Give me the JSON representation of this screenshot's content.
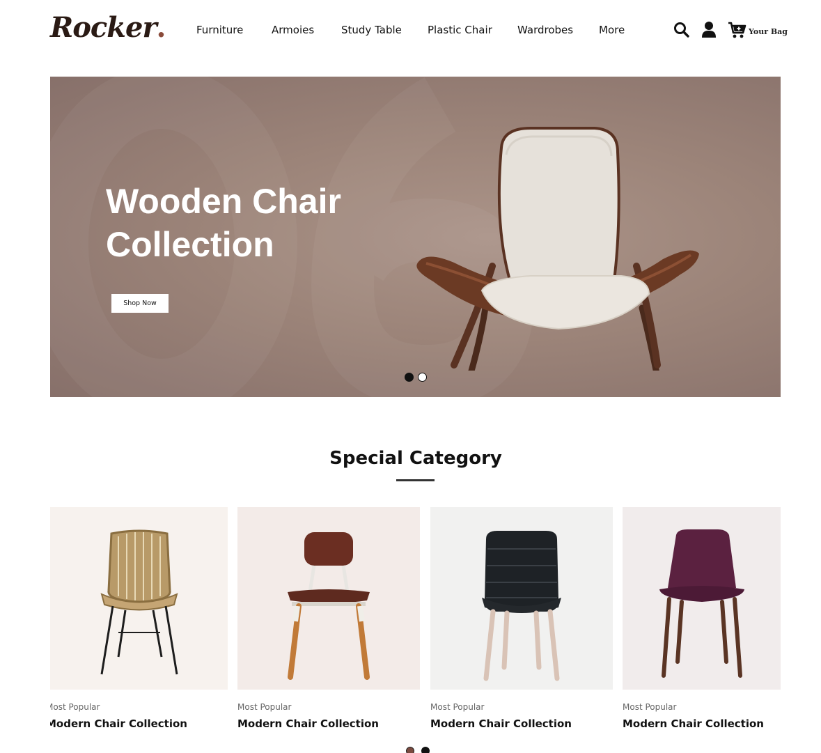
{
  "header": {
    "logo": {
      "text": "Rocker",
      "dot": "."
    },
    "nav": [
      "Furniture",
      "Armoies",
      "Study Table",
      "Plastic Chair",
      "Wardrobes",
      "More"
    ],
    "icons": {
      "search": "search-icon",
      "user": "user-icon",
      "bag": "cart-plus-icon"
    },
    "bag_label": "Your Bag"
  },
  "hero": {
    "title_line1": "Wooden Chair",
    "title_line2": "Collection",
    "button_label": "Shop Now",
    "slides_total": 2,
    "active_slide": 1
  },
  "special": {
    "title": "Special Category",
    "cards": [
      {
        "kicker": "Most Popular",
        "name": "Modern Chair Collection",
        "image": "rattan-chair"
      },
      {
        "kicker": "Most Popular",
        "name": "Modern Chair Collection",
        "image": "leather-wood-chair"
      },
      {
        "kicker": "Most Popular",
        "name": "Modern Chair Collection",
        "image": "black-padded-chair"
      },
      {
        "kicker": "Most Popular",
        "name": "Modern Chair Collection",
        "image": "plum-upholstered-chair"
      }
    ],
    "pages_total": 2,
    "active_page": 1
  },
  "colors": {
    "hero_bg": "#9c8479",
    "logo_accent": "#6b3b2a",
    "text": "#111111"
  }
}
